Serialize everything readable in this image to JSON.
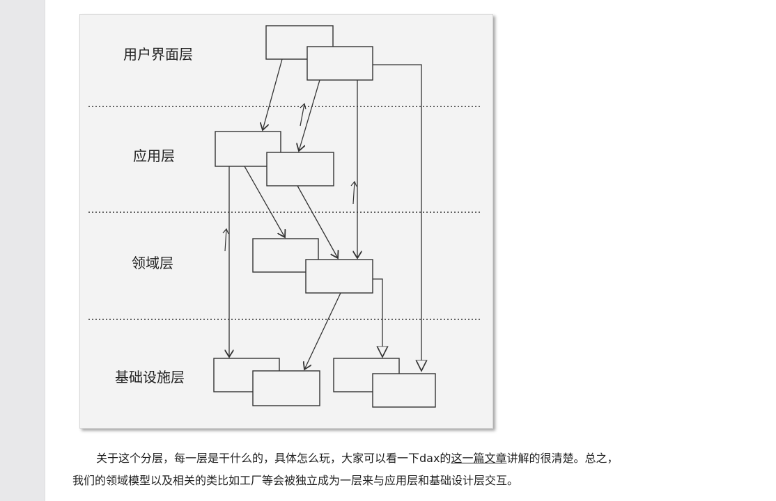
{
  "diagram": {
    "labels": {
      "ui_layer": "用户界面层",
      "app_layer": "应用层",
      "domain_layer": "领域层",
      "infra_layer": "基础设施层"
    },
    "colors": {
      "line": "#333333",
      "background": "#f3f3f3"
    }
  },
  "article": {
    "paragraph_part1": "关于这个分层，每一层是干什么的，具体怎么玩，大家可以看一下dax的",
    "link_text": "这一篇文章",
    "paragraph_part2": "讲解的很清楚。总之，",
    "paragraph_line2": "我们的领域模型以及相关的类比如工厂等会被独立成为一层来与应用层和基础设计层交互。"
  }
}
